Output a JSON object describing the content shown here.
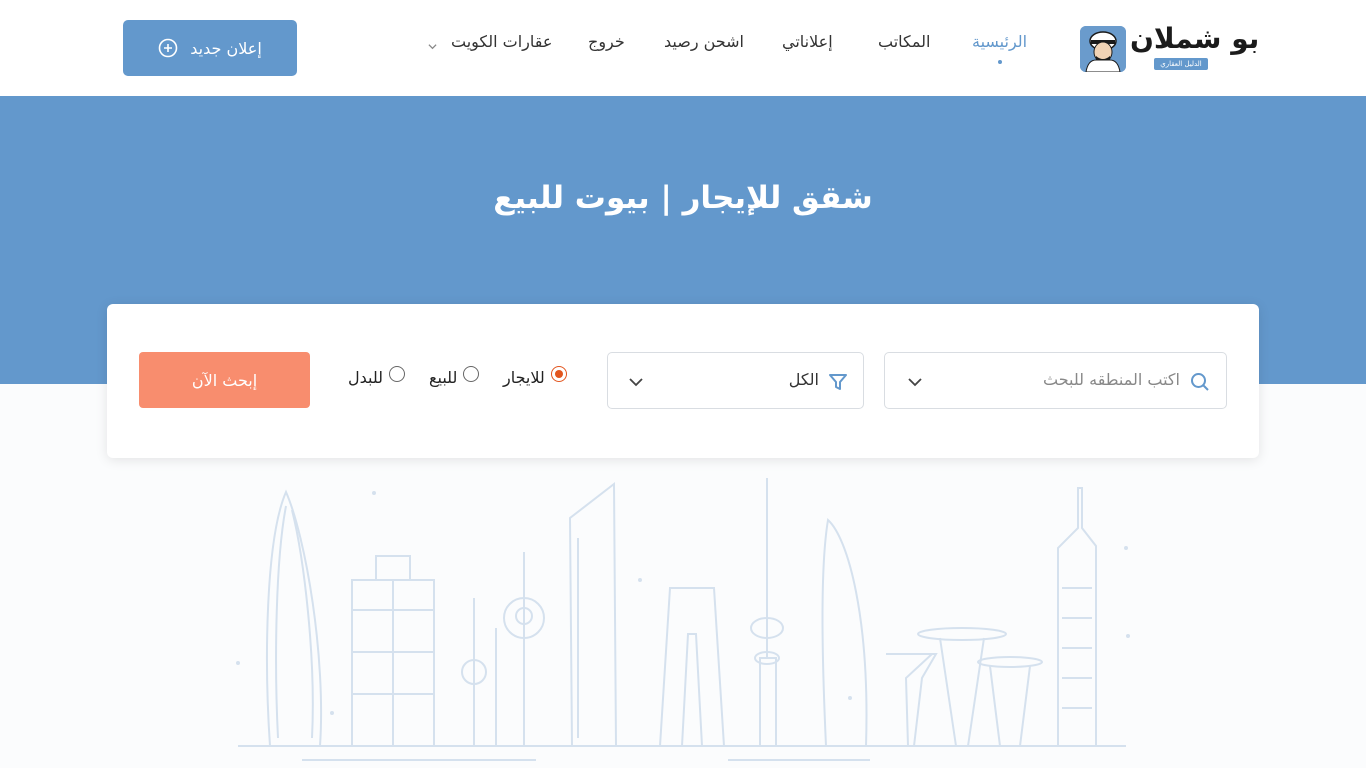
{
  "brand": {
    "name": "بو شملان",
    "tagline": "الدليل العقاري"
  },
  "nav": {
    "home": "الرئيسية",
    "offices": "المكاتب",
    "my_ads": "إعلاناتي",
    "top_up": "اشحن رصيد",
    "logout": "خروج",
    "kuwait_properties": "عقارات الكويت"
  },
  "new_ad_label": "إعلان جديد",
  "hero": {
    "title": "شقق للإيجار | بيوت للبيع"
  },
  "search": {
    "area_placeholder": "اكتب المنطقه للبحث",
    "type_value": "الكل",
    "radios": {
      "rent": "للايجار",
      "sale": "للبيع",
      "exchange": "للبدل"
    },
    "selected": "rent",
    "button": "إبحث الآن"
  },
  "colors": {
    "primary": "#6398cc",
    "accent": "#f88d6e",
    "radio_checked": "#e2551e"
  },
  "icons": {
    "new_ad": "plus-circle-icon",
    "search": "search-icon",
    "filter": "filter-icon",
    "dropdown": "chevron-down-icon"
  }
}
